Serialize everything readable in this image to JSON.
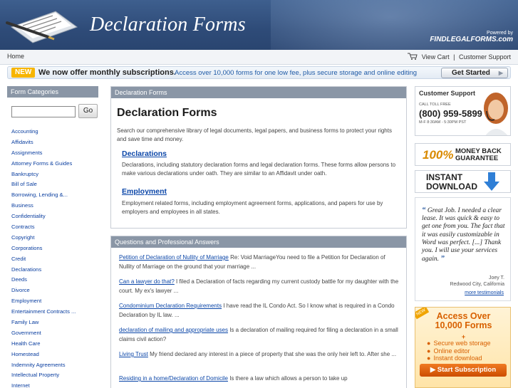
{
  "header": {
    "site_title": "Declaration Forms",
    "powered_by": "Powered by",
    "brand": "FINDLEGALFORMS.com"
  },
  "topnav": {
    "home": "Home",
    "view_cart": "View Cart",
    "separator": "|",
    "customer_support": "Customer Support"
  },
  "promo": {
    "badge": "NEW",
    "headline": "We now offer monthly subscriptions.",
    "text": "Access over 10,000 forms for one low fee, plus secure storage and online editing",
    "button": "Get Started"
  },
  "sidebar": {
    "title": "Form Categories",
    "search_placeholder": "",
    "go_label": "Go",
    "categories": [
      "Accounting",
      "Affidavits",
      "Assignments",
      "Attorney Forms & Guides",
      "Bankruptcy",
      "Bill of Sale",
      "Borrowing, Lending &...",
      "Business",
      "Confidentiality",
      "Contracts",
      "Copyright",
      "Corporations",
      "Credit",
      "Declarations",
      "Deeds",
      "Divorce",
      "Employment",
      "Entertainment Contracts ...",
      "Family Law",
      "Government",
      "Health Care",
      "Homestead",
      "Indemnity Agreements",
      "Intellectual Property",
      "Internet"
    ]
  },
  "declarations": {
    "panel_title": "Declaration Forms",
    "heading": "Declaration Forms",
    "intro": "Search our comprehensive library of legal documents, legal papers, and business forms to protect your rights and save time and money.",
    "sections": [
      {
        "title": "Declarations",
        "desc": "Declarations, including statutory declaration forms and legal declaration forms. These forms allow persons to make various declarations under oath. They are similar to an Affidavit under oath."
      },
      {
        "title": "Employment",
        "desc": "Employment related forms, including employment agreement forms, applications, and papers for use by employers and employees in all states."
      }
    ]
  },
  "qa": {
    "panel_title": "Questions and Professional Answers",
    "items": [
      {
        "link": "Petition of Declaration of Nullity of Marriage",
        "text": " Re: Void MarriageYou need to file a Petition for Declaration of Nullity of Marriage on the ground that your marriage ..."
      },
      {
        "link": "Can a lawyer do that?",
        "text": " I filed a Declaration of facts regarding my current custody battle for my daughter with the court. My ex's lawyer ..."
      },
      {
        "link": "Condominium Declaration Requirements",
        "text": " I have read the IL Condo Act. So I know what is required in a Condo Declaration by IL law. ..."
      },
      {
        "link": "declaration of mailing and appropriate uses",
        "text": " Is a declaration of mailing required for filing a declaration in a small claims civil action?"
      },
      {
        "link": "Living Trust",
        "text": " My friend declared any interest in a piece of property that she was the only heir left to. After she ..."
      },
      {
        "link": "Residing in a home/Declaration of Domicile",
        "text": " Is there a law which allows a person to take up"
      }
    ]
  },
  "support": {
    "title": "Customer Support",
    "toll_label": "CALL TOLL FREE",
    "phone": "(800) 959-5899",
    "hours": "M-F 8:30AM - 5:30PM PST"
  },
  "guarantee": {
    "pct": "100%",
    "line1": "MONEY BACK",
    "line2": "GUARANTEE"
  },
  "download": {
    "line1": "INSTANT",
    "line2": "DOWNLOAD"
  },
  "testimonial": {
    "quote": "Great Job. I needed a clear lease. It was quick & easy to get one from you. The fact that it was easily customizable in Word was perfect. [...] Thank you. I will use your services again.",
    "name": "Joey T.",
    "location": "Redwood City, California",
    "more": "more testimonials"
  },
  "access": {
    "badge": "NEW",
    "title_line1": "Access Over",
    "title_line2": "10,000 Forms",
    "plus": "+",
    "features": [
      "Secure web storage",
      "Online editor",
      "Instant download"
    ],
    "button": "Start Subscription"
  },
  "colors": {
    "header_bg": "#2e4b78",
    "panel_head_bg": "#8a96a6",
    "link": "#0b46a8",
    "accent_orange": "#d86000",
    "badge_yellow": "#f7b500"
  }
}
